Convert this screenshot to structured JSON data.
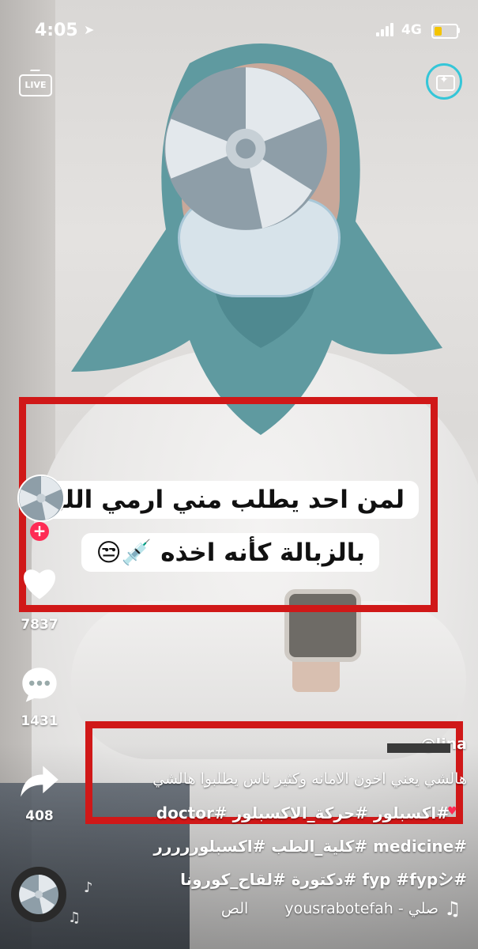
{
  "status_bar": {
    "time": "4:05",
    "network": "4G"
  },
  "top": {
    "live_label": "LIVE"
  },
  "caption": {
    "line1": "لمن احد يطلب مني ارمي اللق",
    "line2": "بالزبالة كأنه اخذه 💉😒"
  },
  "actions": {
    "likes": "7837",
    "comments": "1431",
    "shares": "408"
  },
  "post": {
    "username": "@lina",
    "description": "هالشي يعني اخون الامانه وكثير ناس يطلبوا هالشي",
    "hashtags_1": "#اكسبلور #حركة_الاكسبلور #doctor",
    "hashtags_2": "#medicine #كلية_الطب #اكسبلوررررر",
    "hashtags_3": "#fyp #fypシ #دكتورة #لقاح_كورونا",
    "music": "yousrabotefah - صلي",
    "music_suffix": "الص"
  },
  "colors": {
    "accent_red": "#fe2c55",
    "annotation_red": "#d01818",
    "battery": "#f4c400",
    "hijab": "#5f9aa0"
  }
}
